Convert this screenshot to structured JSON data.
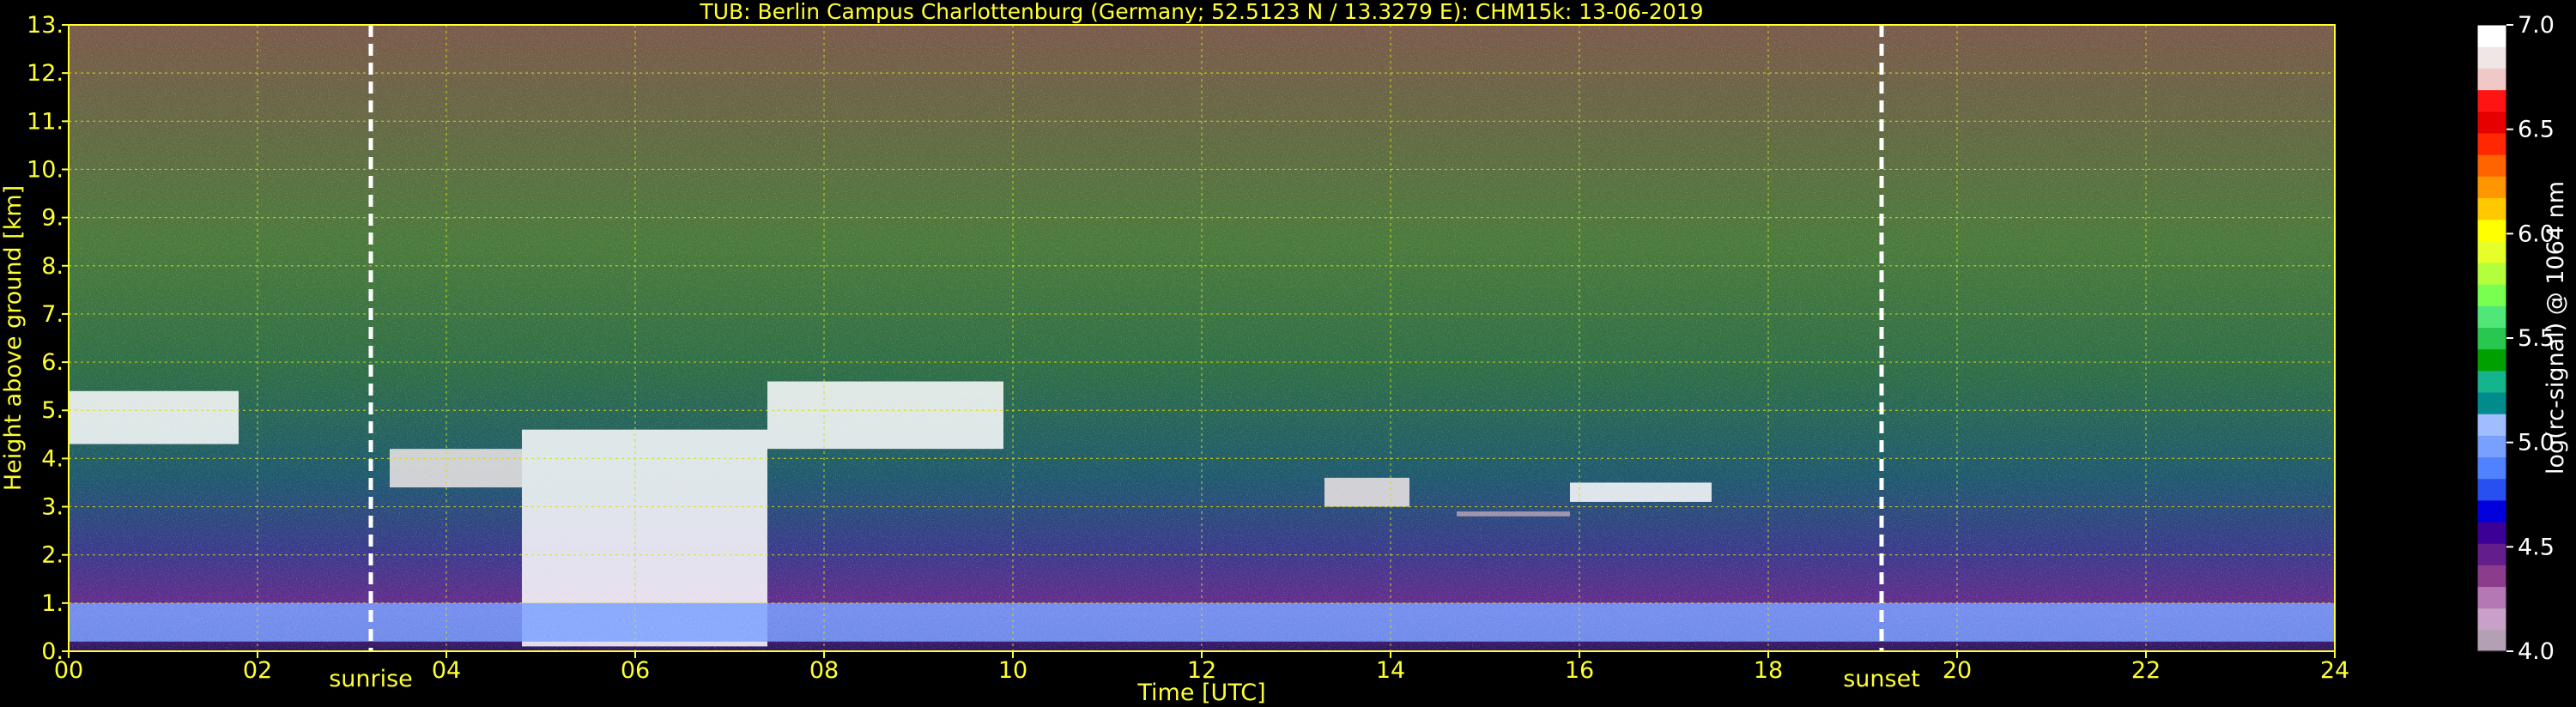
{
  "chart_data": {
    "type": "heatmap",
    "title": "TUB: Berlin Campus Charlottenburg (Germany; 52.5123 N / 13.3279 E):    CHM15k: 13-06-2019",
    "xlabel": "Time [UTC]",
    "ylabel": "Height above ground [km]",
    "xlim": [
      0,
      24
    ],
    "ylim": [
      0,
      13
    ],
    "x_ticks": [
      "00",
      "02",
      "04",
      "06",
      "08",
      "10",
      "12",
      "14",
      "16",
      "18",
      "20",
      "22",
      "24"
    ],
    "y_ticks": [
      "0.",
      "1.",
      "2.",
      "3.",
      "4.",
      "5.",
      "6.",
      "7.",
      "8.",
      "9.",
      "10.",
      "11.",
      "12.",
      "13."
    ],
    "grid": true,
    "annotations": [
      {
        "label": "sunrise",
        "x": 3.2
      },
      {
        "label": "sunset",
        "x": 19.2
      }
    ],
    "colorbar": {
      "label": "log(rc-signal) @ 1064 nm",
      "min": 4.0,
      "max": 7.0,
      "ticks": [
        "4.0",
        "4.5",
        "5.0",
        "5.5",
        "6.0",
        "6.5",
        "7.0"
      ],
      "colors": [
        "#b4a0b4",
        "#c8a0c8",
        "#b478b4",
        "#8c3c8c",
        "#641e8c",
        "#3c0096",
        "#0000dc",
        "#2850f0",
        "#5082ff",
        "#78a0ff",
        "#a0beff",
        "#008c8c",
        "#14b48c",
        "#00a000",
        "#28c850",
        "#50e678",
        "#78ff50",
        "#b4ff3c",
        "#e6ff28",
        "#ffff00",
        "#ffc800",
        "#ff9600",
        "#ff6400",
        "#ff2800",
        "#e60000",
        "#ff1414",
        "#f0c8c8",
        "#f0e6e6",
        "#ffffff"
      ]
    },
    "features": [
      {
        "name": "cloud",
        "t_start": 0.0,
        "t_end": 1.8,
        "height_km": [
          4.3,
          5.4
        ],
        "level": 7.0
      },
      {
        "name": "cloud",
        "t_start": 3.4,
        "t_end": 4.8,
        "height_km": [
          3.4,
          4.2
        ],
        "level": 6.8
      },
      {
        "name": "cloud",
        "t_start": 4.8,
        "t_end": 7.4,
        "height_km": [
          0.1,
          4.6
        ],
        "level": 7.0
      },
      {
        "name": "cloud",
        "t_start": 7.4,
        "t_end": 9.9,
        "height_km": [
          4.2,
          5.6
        ],
        "level": 7.0
      },
      {
        "name": "cloud",
        "t_start": 13.3,
        "t_end": 14.2,
        "height_km": [
          3.0,
          3.6
        ],
        "level": 6.8
      },
      {
        "name": "cloud",
        "t_start": 14.7,
        "t_end": 15.9,
        "height_km": [
          2.8,
          2.9
        ],
        "level": 4.0
      },
      {
        "name": "cloud",
        "t_start": 15.9,
        "t_end": 17.4,
        "height_km": [
          3.1,
          3.5
        ],
        "level": 7.0
      },
      {
        "name": "boundary-layer",
        "t_start": 0.0,
        "t_end": 24.0,
        "height_km": [
          0.2,
          1.0
        ],
        "level": 5.0
      }
    ]
  }
}
